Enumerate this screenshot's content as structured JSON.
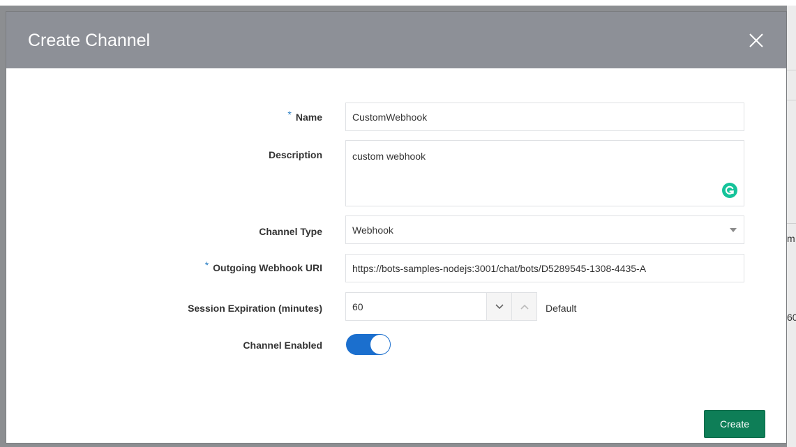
{
  "dialog": {
    "title": "Create Channel",
    "close_icon": "close-icon"
  },
  "background_fragments": {
    "frag1": "m",
    "frag2": "60"
  },
  "form": {
    "required_marker": "*",
    "name": {
      "label": "Name",
      "required": true,
      "value": "CustomWebhook"
    },
    "description": {
      "label": "Description",
      "value": "custom webhook",
      "badge_icon": "grammarly-icon"
    },
    "channel_type": {
      "label": "Channel Type",
      "value": "Webhook",
      "icon": "dropdown-arrow-icon"
    },
    "outgoing_webhook_uri": {
      "label": "Outgoing Webhook URI",
      "required": true,
      "value": "https://bots-samples-nodejs:3001/chat/bots/D5289545-1308-4435-A"
    },
    "session_expiration": {
      "label": "Session Expiration (minutes)",
      "value": "60",
      "default_text": "Default",
      "decrement_icon": "chevron-down-icon",
      "increment_icon": "chevron-up-icon"
    },
    "channel_enabled": {
      "label": "Channel Enabled",
      "enabled": true
    }
  },
  "actions": {
    "create_label": "Create"
  },
  "colors": {
    "header_bg": "#8d9097",
    "toggle_on": "#1b6fce",
    "create_button": "#0e7e57",
    "required_marker": "#2a7fc4",
    "grammarly": "#15c39a"
  }
}
